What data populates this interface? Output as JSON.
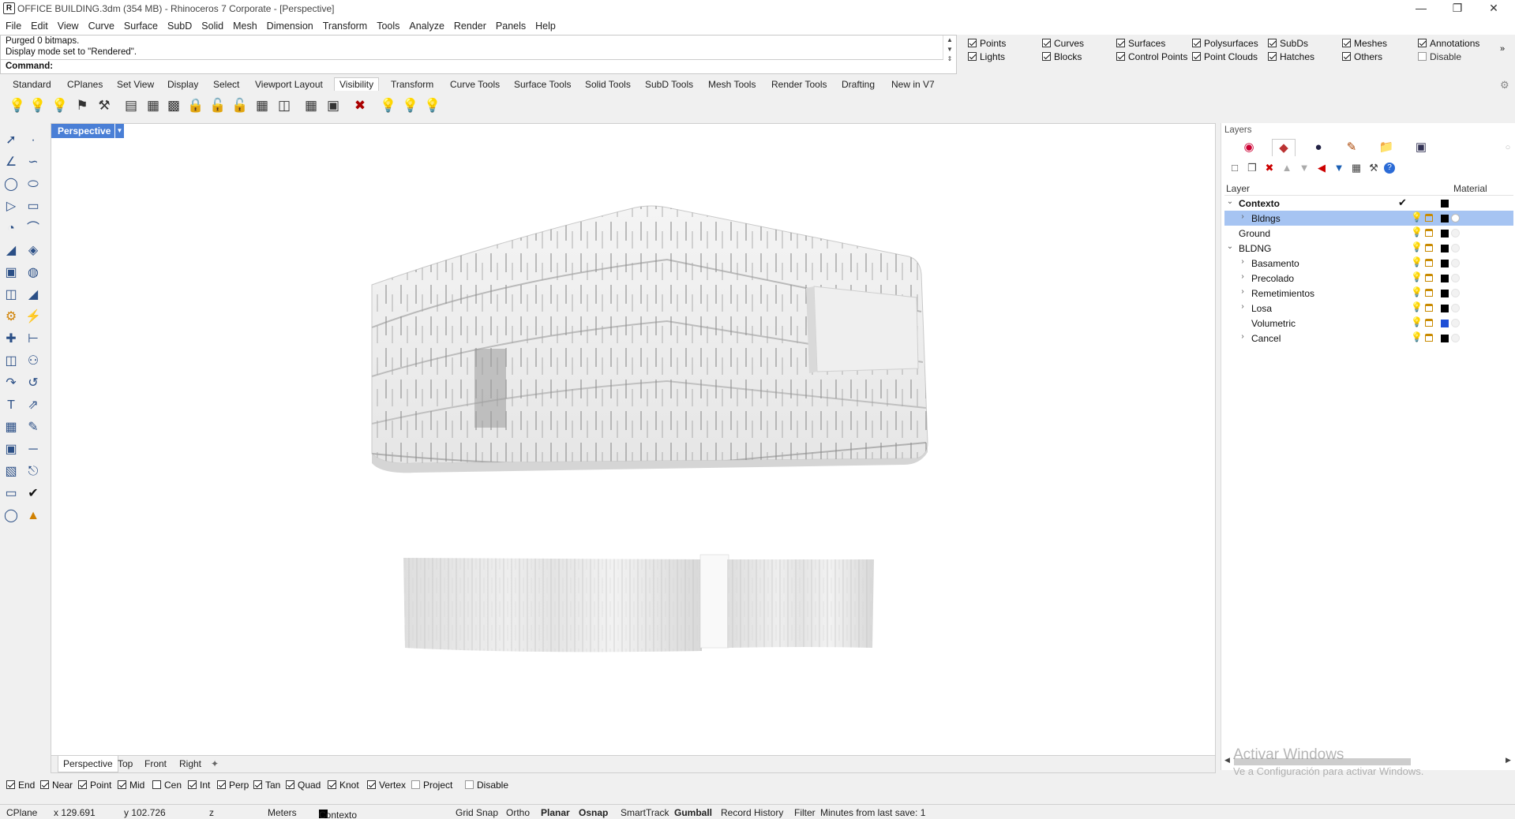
{
  "window": {
    "title": "OFFICE BUILDING.3dm (354 MB) - Rhinoceros 7 Corporate - [Perspective]",
    "app_icon": "rhino-icon",
    "controls": [
      "minimize-icon",
      "restore-icon",
      "close-icon"
    ]
  },
  "menu": [
    "File",
    "Edit",
    "View",
    "Curve",
    "Surface",
    "SubD",
    "Solid",
    "Mesh",
    "Dimension",
    "Transform",
    "Tools",
    "Analyze",
    "Render",
    "Panels",
    "Help"
  ],
  "command": {
    "history": [
      "Purged 0 bitmaps.",
      "Display mode set to \"Rendered\"."
    ],
    "prompt": "Command:",
    "value": ""
  },
  "filters": [
    {
      "label": "Points",
      "checked": true
    },
    {
      "label": "Lights",
      "checked": true
    },
    {
      "label": "Curves",
      "checked": true
    },
    {
      "label": "Blocks",
      "checked": true
    },
    {
      "label": "Surfaces",
      "checked": true
    },
    {
      "label": "Control Points",
      "checked": true
    },
    {
      "label": "Polysurfaces",
      "checked": true
    },
    {
      "label": "Point Clouds",
      "checked": true
    },
    {
      "label": "SubDs",
      "checked": true
    },
    {
      "label": "Hatches",
      "checked": true
    },
    {
      "label": "Meshes",
      "checked": true
    },
    {
      "label": "Others",
      "checked": true
    },
    {
      "label": "Annotations",
      "checked": true
    },
    {
      "label": "Disable",
      "checked": false
    }
  ],
  "tabs": [
    "Standard",
    "CPlanes",
    "Set View",
    "Display",
    "Select",
    "Viewport Layout",
    "Visibility",
    "Transform",
    "Curve Tools",
    "Surface Tools",
    "Solid Tools",
    "SubD Tools",
    "Mesh Tools",
    "Render Tools",
    "Drafting",
    "New in V7"
  ],
  "active_tab": "Visibility",
  "toolbar_icons": [
    "show-icon",
    "show-selected-icon",
    "hide-icon",
    "hide-swap-icon",
    "show-points-icon",
    "lock-icon",
    "lock-selected-icon",
    "unlock-icon",
    "unlock-selected-icon",
    "lock-swap-icon",
    "unlock-all-icon",
    "set-visibility-icon",
    "isolate-icon",
    "hide-in-detail-icon",
    "clear-icon",
    "light-on-icon",
    "light-off-icon",
    "light-icon"
  ],
  "viewport": {
    "name": "Perspective",
    "display_mode": "Rendered"
  },
  "viewport_tabs": [
    "Perspective",
    "Top",
    "Front",
    "Right"
  ],
  "osnaps": [
    {
      "label": "End",
      "checked": true
    },
    {
      "label": "Near",
      "checked": true
    },
    {
      "label": "Point",
      "checked": true
    },
    {
      "label": "Mid",
      "checked": true
    },
    {
      "label": "Cen",
      "checked": false
    },
    {
      "label": "Int",
      "checked": true
    },
    {
      "label": "Perp",
      "checked": true
    },
    {
      "label": "Tan",
      "checked": true
    },
    {
      "label": "Quad",
      "checked": true
    },
    {
      "label": "Knot",
      "checked": true
    },
    {
      "label": "Vertex",
      "checked": true
    },
    {
      "label": "Project",
      "checked": false
    },
    {
      "label": "Disable",
      "checked": false
    }
  ],
  "status": {
    "cplane": "CPlane",
    "x": "x 129.691",
    "y": "y 102.726",
    "z": "z",
    "units": "Meters",
    "layer": "Contexto",
    "buttons": [
      "Grid Snap",
      "Ortho",
      "Planar",
      "Osnap",
      "SmartTrack",
      "Gumball",
      "Record History",
      "Filter"
    ],
    "active_buttons": [
      "Planar",
      "Osnap",
      "Gumball"
    ],
    "save_info": "Minutes from last save: 1"
  },
  "layers_panel": {
    "caption": "Layers",
    "header_layer": "Layer",
    "header_material": "Material",
    "rows": [
      {
        "name": "Contexto",
        "level": 0,
        "expander": "open",
        "bold": true,
        "current": true,
        "color": "#000000"
      },
      {
        "name": "Bldngs",
        "level": 1,
        "expander": "closed",
        "selected": true,
        "color": "#000000"
      },
      {
        "name": "Ground",
        "level": 0,
        "expander": "none",
        "color": "#000000"
      },
      {
        "name": "BLDNG",
        "level": 0,
        "expander": "open",
        "color": "#000000"
      },
      {
        "name": "Basamento",
        "level": 1,
        "expander": "closed",
        "color": "#000000"
      },
      {
        "name": "Precolado",
        "level": 1,
        "expander": "closed",
        "color": "#000000"
      },
      {
        "name": "Remetimientos",
        "level": 1,
        "expander": "closed",
        "color": "#000000"
      },
      {
        "name": "Losa",
        "level": 1,
        "expander": "closed",
        "color": "#000000"
      },
      {
        "name": "Volumetric",
        "level": 1,
        "expander": "none",
        "color": "#1f4fd6"
      },
      {
        "name": "Cancel",
        "level": 1,
        "expander": "closed",
        "color": "#000000"
      }
    ]
  },
  "watermark": {
    "line1": "Activar Windows",
    "line2": "Ve a Configuración para activar Windows."
  }
}
